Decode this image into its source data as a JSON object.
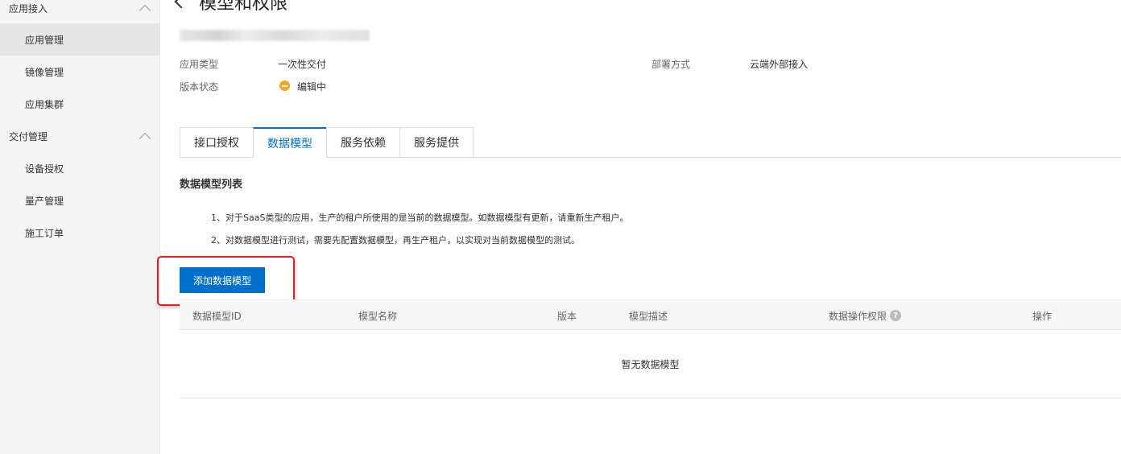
{
  "sidebar": {
    "groups": [
      {
        "title": "应用接入",
        "items": [
          "应用管理",
          "镜像管理",
          "应用集群"
        ]
      },
      {
        "title": "交付管理",
        "items": [
          "设备授权",
          "量产管理",
          "施工订单"
        ]
      }
    ],
    "active_item": "应用管理"
  },
  "page": {
    "title": "模型和权限"
  },
  "info": {
    "app_type_label": "应用类型",
    "app_type_value": "一次性交付",
    "deploy_label": "部署方式",
    "deploy_value": "云端外部接入",
    "version_status_label": "版本状态",
    "version_status_value": "编辑中",
    "status_color": "#f5a623"
  },
  "tabs": [
    {
      "label": "接口授权",
      "active": false
    },
    {
      "label": "数据模型",
      "active": true
    },
    {
      "label": "服务依赖",
      "active": false
    },
    {
      "label": "服务提供",
      "active": false
    }
  ],
  "section": {
    "title": "数据模型列表",
    "notes": [
      "1、对于SaaS类型的应用，生产的租户所使用的是当前的数据模型。如数据模型有更新，请重新生产租户。",
      "2、对数据模型进行测试，需要先配置数据模型，再生产租户，以实现对当前数据模型的测试。"
    ],
    "add_button": "添加数据模型"
  },
  "table": {
    "columns": [
      "数据模型ID",
      "模型名称",
      "版本",
      "模型描述",
      "数据操作权限",
      "操作"
    ],
    "help_symbol": "?",
    "empty_text": "暂无数据模型"
  },
  "colors": {
    "accent": "#0070cc",
    "highlight": "#e02020"
  }
}
